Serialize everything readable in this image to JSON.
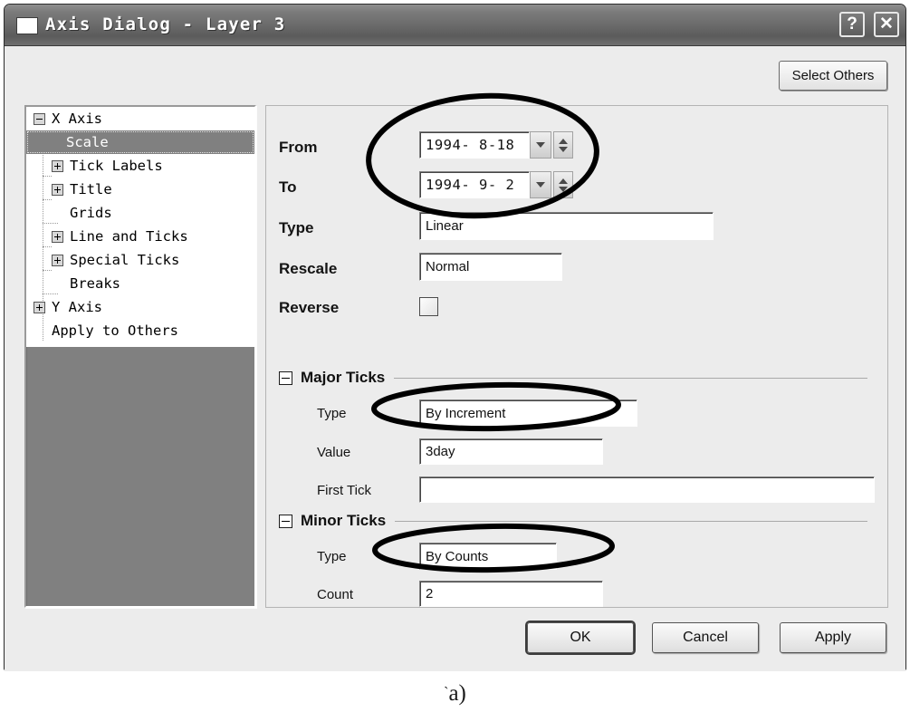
{
  "window": {
    "title": "Axis Dialog - Layer 3",
    "icon": "window-icon",
    "help_label": "?",
    "close_label": "✕"
  },
  "toolbar": {
    "select_others_label": "Select Others"
  },
  "tree": {
    "items": [
      {
        "label": "X Axis",
        "expander": "minus",
        "indent": 0,
        "selected": false
      },
      {
        "label": "Scale",
        "expander": "none",
        "indent": 1,
        "selected": true
      },
      {
        "label": "Tick Labels",
        "expander": "plus",
        "indent": 1,
        "selected": false
      },
      {
        "label": "Title",
        "expander": "plus",
        "indent": 1,
        "selected": false
      },
      {
        "label": "Grids",
        "expander": "none",
        "indent": 1,
        "selected": false
      },
      {
        "label": "Line and Ticks",
        "expander": "plus",
        "indent": 1,
        "selected": false
      },
      {
        "label": "Special Ticks",
        "expander": "plus",
        "indent": 1,
        "selected": false
      },
      {
        "label": "Breaks",
        "expander": "none",
        "indent": 1,
        "selected": false
      },
      {
        "label": "Y Axis",
        "expander": "plus",
        "indent": 0,
        "selected": false
      },
      {
        "label": "Apply to Others",
        "expander": "none",
        "indent": 0,
        "selected": false
      }
    ]
  },
  "scale": {
    "from_label": "From",
    "from_value": "1994- 8-18",
    "to_label": "To",
    "to_value": "1994- 9- 2",
    "type_label": "Type",
    "type_value": "Linear",
    "rescale_label": "Rescale",
    "rescale_value": "Normal",
    "reverse_label": "Reverse",
    "reverse_checked": false
  },
  "major_ticks": {
    "group_label": "Major Ticks",
    "type_label": "Type",
    "type_value": "By Increment",
    "value_label": "Value",
    "value_value": "3day",
    "first_tick_label": "First Tick",
    "first_tick_value": ""
  },
  "minor_ticks": {
    "group_label": "Minor Ticks",
    "type_label": "Type",
    "type_value": "By Counts",
    "count_label": "Count",
    "count_value": "2"
  },
  "buttons": {
    "ok": "OK",
    "cancel": "Cancel",
    "apply": "Apply"
  },
  "figure": {
    "caption": "a)"
  },
  "colors": {
    "window_bg": "#ececec",
    "titlebar": "#6a6a6a",
    "selection": "#808080",
    "annotation": "#000000"
  }
}
